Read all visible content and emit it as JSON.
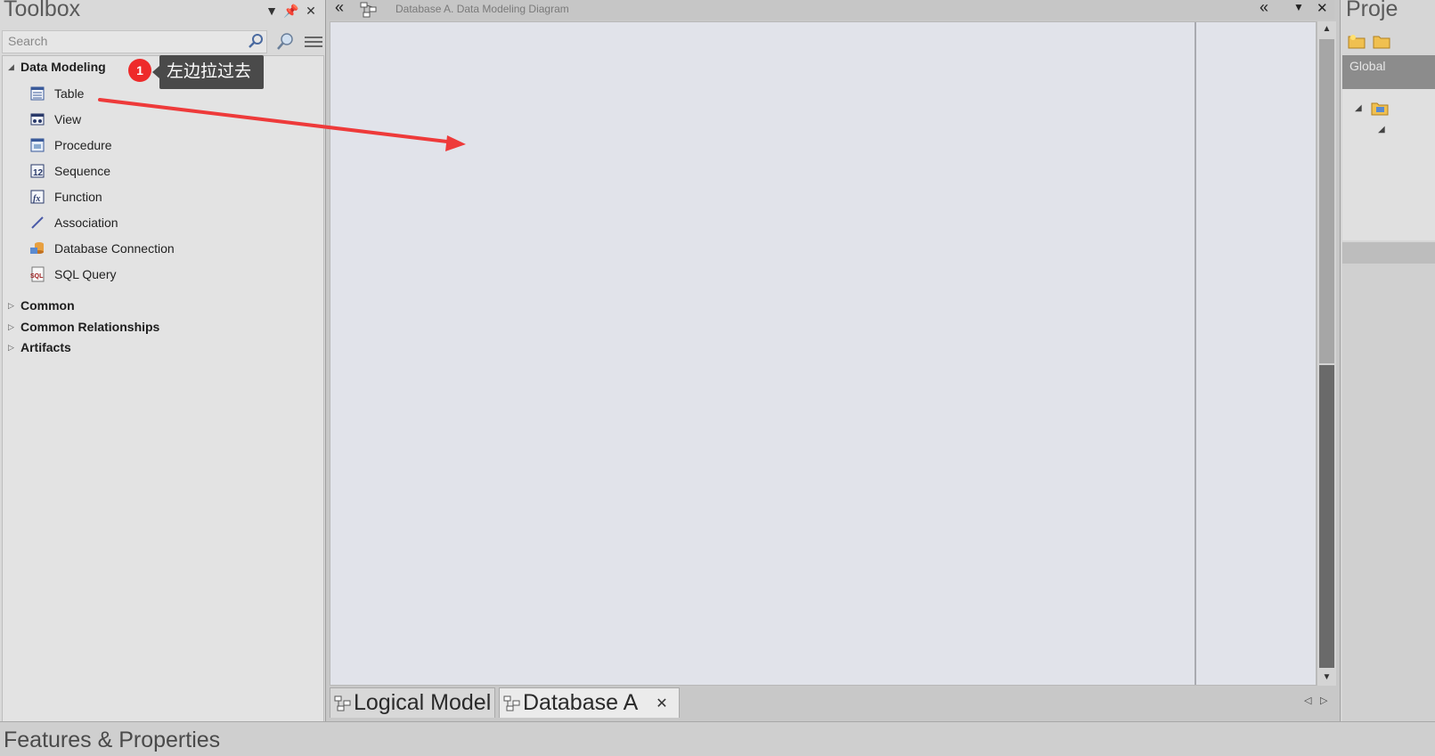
{
  "toolbox": {
    "title": "Toolbox",
    "search_placeholder": "Search",
    "groups": [
      {
        "name": "Data Modeling",
        "expanded": true,
        "items": [
          {
            "label": "Table",
            "icon": "table-icon"
          },
          {
            "label": "View",
            "icon": "view-icon"
          },
          {
            "label": "Procedure",
            "icon": "procedure-icon"
          },
          {
            "label": "Sequence",
            "icon": "sequence-icon"
          },
          {
            "label": "Function",
            "icon": "function-icon"
          },
          {
            "label": "Association",
            "icon": "association-icon"
          },
          {
            "label": "Database Connection",
            "icon": "database-connection-icon"
          },
          {
            "label": "SQL Query",
            "icon": "sql-query-icon"
          }
        ]
      },
      {
        "name": "Common",
        "expanded": false
      },
      {
        "name": "Common Relationships",
        "expanded": false
      },
      {
        "name": "Artifacts",
        "expanded": false
      }
    ]
  },
  "annotation": {
    "number": "1",
    "text": "左边拉过去",
    "number_color": "#ee2a2a",
    "arrow_color": "#ee3a3a"
  },
  "diagram": {
    "header_title": "Database A.  Data Modeling Diagram",
    "canvas_color": "#e1e3ea"
  },
  "tabs": [
    {
      "label": "Logical Model",
      "active": false
    },
    {
      "label": "Database A",
      "active": true,
      "closable": true
    }
  ],
  "tab_close_glyph": "✕",
  "project": {
    "title": "Proje",
    "tab": "Global"
  },
  "bottom_panel": {
    "title": "Features & Properties"
  }
}
